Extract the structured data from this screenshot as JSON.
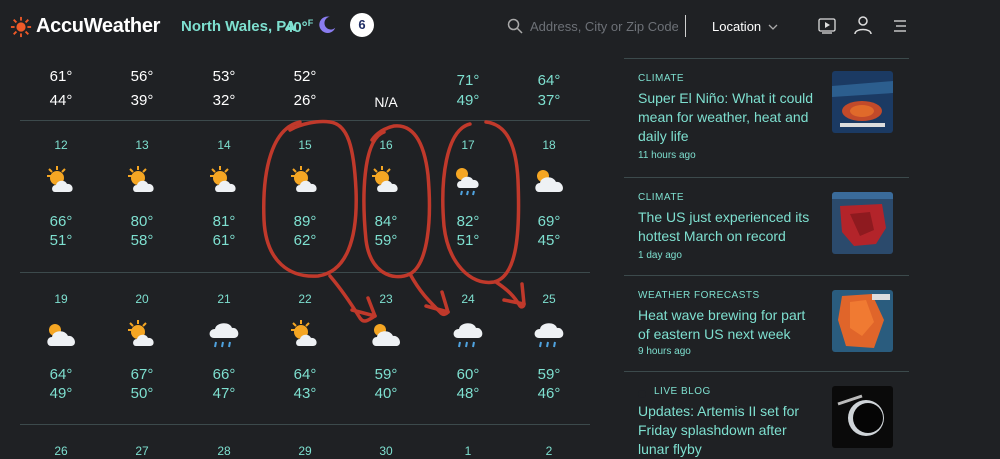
{
  "header": {
    "brand": "AccuWeather",
    "location": "North Wales, PA",
    "temp": "40°",
    "temp_unit": "F",
    "station": "6",
    "search_placeholder": "Address, City or Zip Code",
    "location_dropdown": "Location"
  },
  "forecast": {
    "row0": [
      {
        "hi": "61°",
        "lo": "44°",
        "white": true
      },
      {
        "hi": "56°",
        "lo": "39°",
        "white": true
      },
      {
        "hi": "53°",
        "lo": "32°",
        "white": true
      },
      {
        "hi": "52°",
        "lo": "26°",
        "white": true
      },
      {
        "na": "N/A"
      },
      {
        "hi": "71°",
        "lo": "49°",
        "white": false
      },
      {
        "hi": "64°",
        "lo": "37°",
        "white": false
      }
    ],
    "row1": [
      {
        "day": "12",
        "icon": "partly-sunny-icon",
        "hi": "66°",
        "lo": "51°"
      },
      {
        "day": "13",
        "icon": "partly-sunny-icon",
        "hi": "80°",
        "lo": "58°"
      },
      {
        "day": "14",
        "icon": "partly-sunny-icon",
        "hi": "81°",
        "lo": "61°"
      },
      {
        "day": "15",
        "icon": "partly-sunny-icon",
        "hi": "89°",
        "lo": "62°"
      },
      {
        "day": "16",
        "icon": "partly-sunny-icon",
        "hi": "84°",
        "lo": "59°"
      },
      {
        "day": "17",
        "icon": "sun-showers-icon",
        "hi": "82°",
        "lo": "51°"
      },
      {
        "day": "18",
        "icon": "mostly-cloudy-icon",
        "hi": "69°",
        "lo": "45°"
      }
    ],
    "row2": [
      {
        "day": "19",
        "icon": "mostly-cloudy-icon",
        "hi": "64°",
        "lo": "49°"
      },
      {
        "day": "20",
        "icon": "partly-sunny-icon",
        "hi": "67°",
        "lo": "50°"
      },
      {
        "day": "21",
        "icon": "rain-icon",
        "hi": "66°",
        "lo": "47°"
      },
      {
        "day": "22",
        "icon": "partly-sunny-icon",
        "hi": "64°",
        "lo": "43°"
      },
      {
        "day": "23",
        "icon": "mostly-cloudy-icon",
        "hi": "59°",
        "lo": "40°"
      },
      {
        "day": "24",
        "icon": "rain-icon",
        "hi": "60°",
        "lo": "48°"
      },
      {
        "day": "25",
        "icon": "rain-icon",
        "hi": "59°",
        "lo": "46°"
      }
    ],
    "row3": [
      {
        "day": "26"
      },
      {
        "day": "27"
      },
      {
        "day": "28"
      },
      {
        "day": "29"
      },
      {
        "day": "30"
      },
      {
        "day": "1"
      },
      {
        "day": "2"
      }
    ]
  },
  "news": [
    {
      "category": "CLIMATE",
      "title": "Super El Niño: What it could mean for weather, heat and daily life",
      "time": "11 hours ago"
    },
    {
      "category": "CLIMATE",
      "title": "The US just experienced its hottest March on record",
      "time": "1 day ago"
    },
    {
      "category": "WEATHER FORECASTS",
      "title": "Heat wave brewing for part of eastern US next week",
      "time": "9 hours ago"
    },
    {
      "category": "LIVE BLOG",
      "title": "Updates: Artemis II set for Friday splashdown after lunar flyby",
      "time": ""
    }
  ],
  "colors": {
    "accent": "#7ee0d0",
    "background": "#1f2124",
    "annotation": "#c0392b"
  }
}
